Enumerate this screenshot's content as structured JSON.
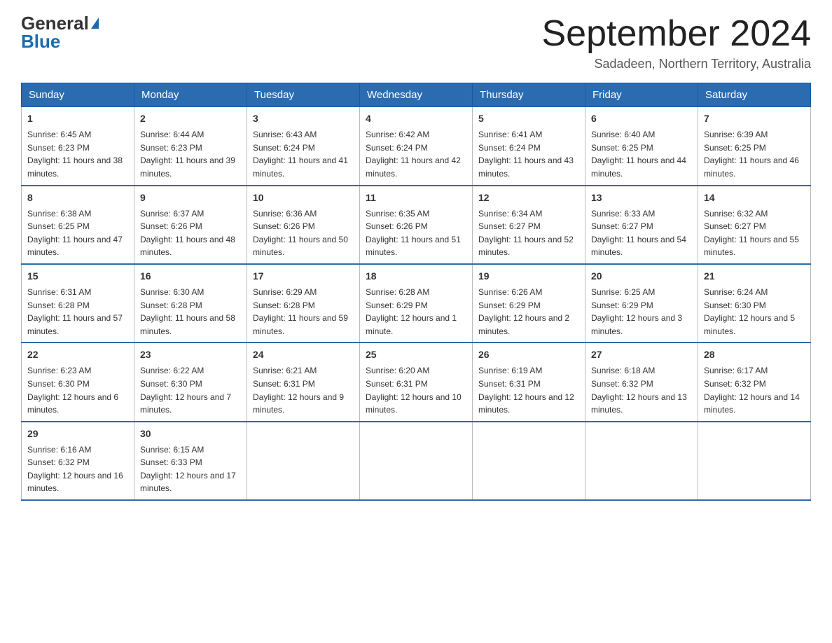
{
  "header": {
    "logo_line1": "General",
    "logo_line2": "Blue",
    "month_title": "September 2024",
    "subtitle": "Sadadeen, Northern Territory, Australia"
  },
  "calendar": {
    "days_of_week": [
      "Sunday",
      "Monday",
      "Tuesday",
      "Wednesday",
      "Thursday",
      "Friday",
      "Saturday"
    ],
    "weeks": [
      [
        {
          "day": "1",
          "sunrise": "Sunrise: 6:45 AM",
          "sunset": "Sunset: 6:23 PM",
          "daylight": "Daylight: 11 hours and 38 minutes."
        },
        {
          "day": "2",
          "sunrise": "Sunrise: 6:44 AM",
          "sunset": "Sunset: 6:23 PM",
          "daylight": "Daylight: 11 hours and 39 minutes."
        },
        {
          "day": "3",
          "sunrise": "Sunrise: 6:43 AM",
          "sunset": "Sunset: 6:24 PM",
          "daylight": "Daylight: 11 hours and 41 minutes."
        },
        {
          "day": "4",
          "sunrise": "Sunrise: 6:42 AM",
          "sunset": "Sunset: 6:24 PM",
          "daylight": "Daylight: 11 hours and 42 minutes."
        },
        {
          "day": "5",
          "sunrise": "Sunrise: 6:41 AM",
          "sunset": "Sunset: 6:24 PM",
          "daylight": "Daylight: 11 hours and 43 minutes."
        },
        {
          "day": "6",
          "sunrise": "Sunrise: 6:40 AM",
          "sunset": "Sunset: 6:25 PM",
          "daylight": "Daylight: 11 hours and 44 minutes."
        },
        {
          "day": "7",
          "sunrise": "Sunrise: 6:39 AM",
          "sunset": "Sunset: 6:25 PM",
          "daylight": "Daylight: 11 hours and 46 minutes."
        }
      ],
      [
        {
          "day": "8",
          "sunrise": "Sunrise: 6:38 AM",
          "sunset": "Sunset: 6:25 PM",
          "daylight": "Daylight: 11 hours and 47 minutes."
        },
        {
          "day": "9",
          "sunrise": "Sunrise: 6:37 AM",
          "sunset": "Sunset: 6:26 PM",
          "daylight": "Daylight: 11 hours and 48 minutes."
        },
        {
          "day": "10",
          "sunrise": "Sunrise: 6:36 AM",
          "sunset": "Sunset: 6:26 PM",
          "daylight": "Daylight: 11 hours and 50 minutes."
        },
        {
          "day": "11",
          "sunrise": "Sunrise: 6:35 AM",
          "sunset": "Sunset: 6:26 PM",
          "daylight": "Daylight: 11 hours and 51 minutes."
        },
        {
          "day": "12",
          "sunrise": "Sunrise: 6:34 AM",
          "sunset": "Sunset: 6:27 PM",
          "daylight": "Daylight: 11 hours and 52 minutes."
        },
        {
          "day": "13",
          "sunrise": "Sunrise: 6:33 AM",
          "sunset": "Sunset: 6:27 PM",
          "daylight": "Daylight: 11 hours and 54 minutes."
        },
        {
          "day": "14",
          "sunrise": "Sunrise: 6:32 AM",
          "sunset": "Sunset: 6:27 PM",
          "daylight": "Daylight: 11 hours and 55 minutes."
        }
      ],
      [
        {
          "day": "15",
          "sunrise": "Sunrise: 6:31 AM",
          "sunset": "Sunset: 6:28 PM",
          "daylight": "Daylight: 11 hours and 57 minutes."
        },
        {
          "day": "16",
          "sunrise": "Sunrise: 6:30 AM",
          "sunset": "Sunset: 6:28 PM",
          "daylight": "Daylight: 11 hours and 58 minutes."
        },
        {
          "day": "17",
          "sunrise": "Sunrise: 6:29 AM",
          "sunset": "Sunset: 6:28 PM",
          "daylight": "Daylight: 11 hours and 59 minutes."
        },
        {
          "day": "18",
          "sunrise": "Sunrise: 6:28 AM",
          "sunset": "Sunset: 6:29 PM",
          "daylight": "Daylight: 12 hours and 1 minute."
        },
        {
          "day": "19",
          "sunrise": "Sunrise: 6:26 AM",
          "sunset": "Sunset: 6:29 PM",
          "daylight": "Daylight: 12 hours and 2 minutes."
        },
        {
          "day": "20",
          "sunrise": "Sunrise: 6:25 AM",
          "sunset": "Sunset: 6:29 PM",
          "daylight": "Daylight: 12 hours and 3 minutes."
        },
        {
          "day": "21",
          "sunrise": "Sunrise: 6:24 AM",
          "sunset": "Sunset: 6:30 PM",
          "daylight": "Daylight: 12 hours and 5 minutes."
        }
      ],
      [
        {
          "day": "22",
          "sunrise": "Sunrise: 6:23 AM",
          "sunset": "Sunset: 6:30 PM",
          "daylight": "Daylight: 12 hours and 6 minutes."
        },
        {
          "day": "23",
          "sunrise": "Sunrise: 6:22 AM",
          "sunset": "Sunset: 6:30 PM",
          "daylight": "Daylight: 12 hours and 7 minutes."
        },
        {
          "day": "24",
          "sunrise": "Sunrise: 6:21 AM",
          "sunset": "Sunset: 6:31 PM",
          "daylight": "Daylight: 12 hours and 9 minutes."
        },
        {
          "day": "25",
          "sunrise": "Sunrise: 6:20 AM",
          "sunset": "Sunset: 6:31 PM",
          "daylight": "Daylight: 12 hours and 10 minutes."
        },
        {
          "day": "26",
          "sunrise": "Sunrise: 6:19 AM",
          "sunset": "Sunset: 6:31 PM",
          "daylight": "Daylight: 12 hours and 12 minutes."
        },
        {
          "day": "27",
          "sunrise": "Sunrise: 6:18 AM",
          "sunset": "Sunset: 6:32 PM",
          "daylight": "Daylight: 12 hours and 13 minutes."
        },
        {
          "day": "28",
          "sunrise": "Sunrise: 6:17 AM",
          "sunset": "Sunset: 6:32 PM",
          "daylight": "Daylight: 12 hours and 14 minutes."
        }
      ],
      [
        {
          "day": "29",
          "sunrise": "Sunrise: 6:16 AM",
          "sunset": "Sunset: 6:32 PM",
          "daylight": "Daylight: 12 hours and 16 minutes."
        },
        {
          "day": "30",
          "sunrise": "Sunrise: 6:15 AM",
          "sunset": "Sunset: 6:33 PM",
          "daylight": "Daylight: 12 hours and 17 minutes."
        },
        null,
        null,
        null,
        null,
        null
      ]
    ]
  }
}
